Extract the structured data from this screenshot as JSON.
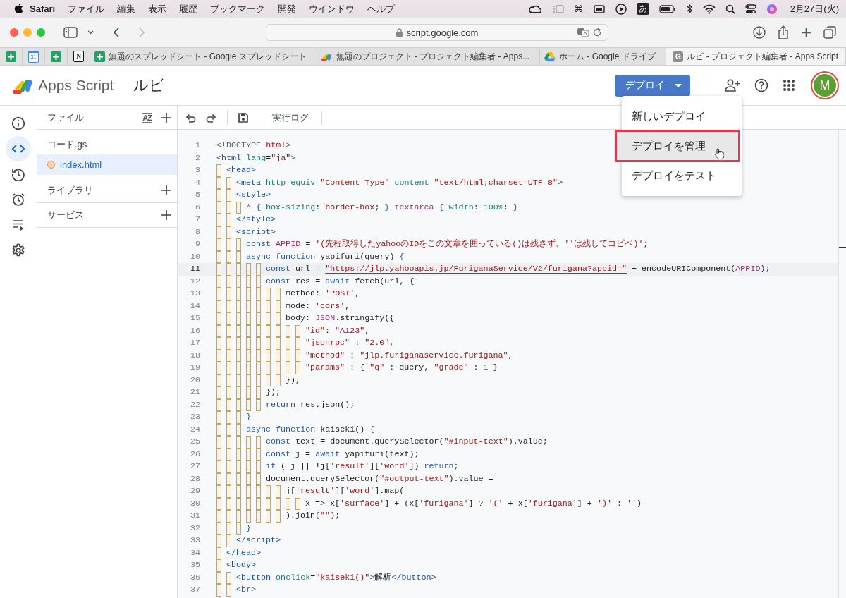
{
  "menubar": {
    "app": "Safari",
    "items": [
      "ファイル",
      "編集",
      "表示",
      "履歴",
      "ブックマーク",
      "開発",
      "ウインドウ",
      "ヘルプ"
    ],
    "command_glyph": "⌘",
    "input_mode": "あ",
    "clock": "2月27日(火)"
  },
  "browser": {
    "address": "script.google.com",
    "pinned_tabs": [
      {
        "kind": "sheets"
      },
      {
        "kind": "calendar",
        "icon_label": "31"
      },
      {
        "kind": "sheets"
      },
      {
        "kind": "notion",
        "icon_label": "N"
      }
    ],
    "tabs": [
      {
        "kind": "sheets",
        "title": "無題のスプレッドシート - Google スプレッドシート",
        "selected": false
      },
      {
        "kind": "apps-script",
        "title": "無題のプロジェクト - プロジェクト編集者 - Apps...",
        "selected": false
      },
      {
        "kind": "drive",
        "title": "ホーム - Google ドライブ",
        "selected": false
      },
      {
        "kind": "letter",
        "icon_label": "G",
        "title": "ルビ - プロジェクト編集者 - Apps Script",
        "selected": true
      }
    ]
  },
  "header": {
    "product": "Apps Script",
    "project": "ルビ",
    "deploy_button": "デプロイ",
    "avatar": "M"
  },
  "deploy_menu": [
    {
      "label": "新しいデプロイ",
      "highlighted": false
    },
    {
      "label": "デプロイを管理",
      "highlighted": true
    },
    {
      "label": "デプロイをテスト",
      "highlighted": false
    }
  ],
  "rail": [
    {
      "kind": "info",
      "selected": false
    },
    {
      "kind": "code",
      "selected": true
    },
    {
      "kind": "history",
      "selected": false
    },
    {
      "kind": "alarm",
      "selected": false
    },
    {
      "kind": "executions",
      "selected": false
    },
    {
      "kind": "settings",
      "selected": false
    }
  ],
  "files": {
    "title": "ファイル",
    "sort_label": "AZ",
    "items": [
      {
        "name": "コード.gs",
        "selected": false,
        "unsaved": false
      },
      {
        "name": "index.html",
        "selected": true,
        "unsaved": true
      }
    ],
    "sections": [
      "ライブラリ",
      "サービス"
    ]
  },
  "editor": {
    "log_button": "実行ログ",
    "lines": [
      {
        "number": "1",
        "current": false,
        "tokens": [
          {
            "kind": "meta",
            "text": "<!DOCTYPE "
          },
          {
            "kind": "string",
            "text": "html"
          },
          {
            "kind": "meta",
            "text": ">"
          }
        ]
      },
      {
        "number": "2",
        "current": false,
        "tokens": [
          {
            "kind": "tag",
            "text": "<html "
          },
          {
            "kind": "attr",
            "text": "lang"
          },
          {
            "kind": "plain",
            "text": "="
          },
          {
            "kind": "string",
            "text": "\"ja\""
          },
          {
            "kind": "tag",
            "text": ">"
          }
        ]
      },
      {
        "number": "3",
        "current": false,
        "tokens": [
          {
            "kind": "tag",
            "text": "  <head>"
          }
        ]
      },
      {
        "number": "4",
        "current": false,
        "tokens": [
          {
            "kind": "tag",
            "text": "    <meta "
          },
          {
            "kind": "attr",
            "text": "http-equiv"
          },
          {
            "kind": "plain",
            "text": "="
          },
          {
            "kind": "string",
            "text": "\"Content-Type\""
          },
          {
            "kind": "attr",
            "text": " content"
          },
          {
            "kind": "plain",
            "text": "="
          },
          {
            "kind": "string",
            "text": "\"text/html;charset=UTF-8\""
          },
          {
            "kind": "tag",
            "text": ">"
          }
        ]
      },
      {
        "number": "5",
        "current": false,
        "tokens": [
          {
            "kind": "tag",
            "text": "    <style>"
          }
        ]
      },
      {
        "number": "6",
        "current": false,
        "tokens": [
          {
            "kind": "var",
            "text": "      *"
          },
          {
            "kind": "bracket",
            "text": " {"
          },
          {
            "kind": "attr",
            "text": " box-sizing"
          },
          {
            "kind": "plain",
            "text": ": "
          },
          {
            "kind": "string",
            "text": "border-box"
          },
          {
            "kind": "plain",
            "text": "; "
          },
          {
            "kind": "bracket",
            "text": "}"
          },
          {
            "kind": "var",
            "text": " textarea"
          },
          {
            "kind": "bracket",
            "text": " {"
          },
          {
            "kind": "attr",
            "text": " width"
          },
          {
            "kind": "plain",
            "text": ": "
          },
          {
            "kind": "number",
            "text": "100%"
          },
          {
            "kind": "plain",
            "text": "; "
          },
          {
            "kind": "bracket",
            "text": "}"
          }
        ]
      },
      {
        "number": "7",
        "current": false,
        "tokens": [
          {
            "kind": "tag",
            "text": "    </style>"
          }
        ]
      },
      {
        "number": "8",
        "current": false,
        "tokens": [
          {
            "kind": "tag",
            "text": "    <script>"
          }
        ]
      },
      {
        "number": "9",
        "current": false,
        "tokens": [
          {
            "kind": "keyword",
            "text": "      const"
          },
          {
            "kind": "var",
            "text": " APPID"
          },
          {
            "kind": "plain",
            "text": " = "
          },
          {
            "kind": "string",
            "text": "'(先程取得したyahooのIDをこの文章を囲っている()は残さず、''は残してコピペ)'"
          },
          {
            "kind": "plain",
            "text": ";"
          }
        ]
      },
      {
        "number": "10",
        "current": false,
        "tokens": [
          {
            "kind": "keyword",
            "text": "      async function"
          },
          {
            "kind": "plain",
            "text": " yapifuri(query) "
          },
          {
            "kind": "bracket",
            "text": "{"
          }
        ]
      },
      {
        "number": "11",
        "current": true,
        "tokens": [
          {
            "kind": "keyword",
            "text": "          const"
          },
          {
            "kind": "plain",
            "text": " url = "
          },
          {
            "kind": "error-string",
            "text": "\"https://jlp.yahooapis.jp/FuriganaService/V2/furigana?appid=\""
          },
          {
            "kind": "plain",
            "text": " + encodeURIComponent("
          },
          {
            "kind": "var",
            "text": "APPID"
          },
          {
            "kind": "plain",
            "text": ");"
          }
        ]
      },
      {
        "number": "12",
        "current": false,
        "tokens": [
          {
            "kind": "keyword",
            "text": "          const"
          },
          {
            "kind": "plain",
            "text": " res = "
          },
          {
            "kind": "keyword",
            "text": "await"
          },
          {
            "kind": "plain",
            "text": " fetch(url, {"
          }
        ]
      },
      {
        "number": "13",
        "current": false,
        "tokens": [
          {
            "kind": "plain",
            "text": "              method: "
          },
          {
            "kind": "string",
            "text": "'POST'"
          },
          {
            "kind": "plain",
            "text": ","
          }
        ]
      },
      {
        "number": "14",
        "current": false,
        "tokens": [
          {
            "kind": "plain",
            "text": "              mode: "
          },
          {
            "kind": "string",
            "text": "'cors'"
          },
          {
            "kind": "plain",
            "text": ","
          }
        ]
      },
      {
        "number": "15",
        "current": false,
        "tokens": [
          {
            "kind": "plain",
            "text": "              body: "
          },
          {
            "kind": "var",
            "text": "JSON"
          },
          {
            "kind": "plain",
            "text": ".stringify({"
          }
        ]
      },
      {
        "number": "16",
        "current": false,
        "tokens": [
          {
            "kind": "string",
            "text": "                  \"id\""
          },
          {
            "kind": "plain",
            "text": ": "
          },
          {
            "kind": "string",
            "text": "\"A123\""
          },
          {
            "kind": "plain",
            "text": ","
          }
        ]
      },
      {
        "number": "17",
        "current": false,
        "tokens": [
          {
            "kind": "string",
            "text": "                  \"jsonrpc\""
          },
          {
            "kind": "plain",
            "text": " : "
          },
          {
            "kind": "string",
            "text": "\"2.0\""
          },
          {
            "kind": "plain",
            "text": ","
          }
        ]
      },
      {
        "number": "18",
        "current": false,
        "tokens": [
          {
            "kind": "string",
            "text": "                  \"method\""
          },
          {
            "kind": "plain",
            "text": " : "
          },
          {
            "kind": "string",
            "text": "\"jlp.furiganaservice.furigana\""
          },
          {
            "kind": "plain",
            "text": ","
          }
        ]
      },
      {
        "number": "19",
        "current": false,
        "tokens": [
          {
            "kind": "string",
            "text": "                  \"params\""
          },
          {
            "kind": "plain",
            "text": " : { "
          },
          {
            "kind": "string",
            "text": "\"q\""
          },
          {
            "kind": "plain",
            "text": " : query, "
          },
          {
            "kind": "string",
            "text": "\"grade\""
          },
          {
            "kind": "plain",
            "text": " : "
          },
          {
            "kind": "number",
            "text": "1"
          },
          {
            "kind": "plain",
            "text": " }"
          }
        ]
      },
      {
        "number": "20",
        "current": false,
        "tokens": [
          {
            "kind": "plain",
            "text": "              }),"
          }
        ]
      },
      {
        "number": "21",
        "current": false,
        "tokens": [
          {
            "kind": "plain",
            "text": "          });"
          }
        ]
      },
      {
        "number": "22",
        "current": false,
        "tokens": [
          {
            "kind": "keyword",
            "text": "          return"
          },
          {
            "kind": "plain",
            "text": " res.json();"
          }
        ]
      },
      {
        "number": "23",
        "current": false,
        "tokens": [
          {
            "kind": "bracket",
            "text": "      }"
          }
        ]
      },
      {
        "number": "24",
        "current": false,
        "tokens": [
          {
            "kind": "keyword",
            "text": "      async function"
          },
          {
            "kind": "plain",
            "text": " kaiseki() "
          },
          {
            "kind": "bracket",
            "text": "{"
          }
        ]
      },
      {
        "number": "25",
        "current": false,
        "tokens": [
          {
            "kind": "keyword",
            "text": "          const"
          },
          {
            "kind": "plain",
            "text": " text = document.querySelector("
          },
          {
            "kind": "string",
            "text": "\"#input-text\""
          },
          {
            "kind": "plain",
            "text": ").value;"
          }
        ]
      },
      {
        "number": "26",
        "current": false,
        "tokens": [
          {
            "kind": "keyword",
            "text": "          const"
          },
          {
            "kind": "plain",
            "text": " j = "
          },
          {
            "kind": "keyword",
            "text": "await"
          },
          {
            "kind": "plain",
            "text": " yapifuri(text);"
          }
        ]
      },
      {
        "number": "27",
        "current": false,
        "tokens": [
          {
            "kind": "keyword",
            "text": "          if"
          },
          {
            "kind": "plain",
            "text": " (!j || !j["
          },
          {
            "kind": "string",
            "text": "'result'"
          },
          {
            "kind": "plain",
            "text": "]["
          },
          {
            "kind": "string",
            "text": "'word'"
          },
          {
            "kind": "plain",
            "text": "]) "
          },
          {
            "kind": "keyword",
            "text": "return"
          },
          {
            "kind": "plain",
            "text": ";"
          }
        ]
      },
      {
        "number": "28",
        "current": false,
        "tokens": [
          {
            "kind": "plain",
            "text": "          document.querySelector("
          },
          {
            "kind": "string",
            "text": "\"#output-text\""
          },
          {
            "kind": "plain",
            "text": ").value ="
          }
        ]
      },
      {
        "number": "29",
        "current": false,
        "tokens": [
          {
            "kind": "plain",
            "text": "              j["
          },
          {
            "kind": "string",
            "text": "'result'"
          },
          {
            "kind": "plain",
            "text": "]["
          },
          {
            "kind": "string",
            "text": "'word'"
          },
          {
            "kind": "plain",
            "text": "].map("
          }
        ]
      },
      {
        "number": "30",
        "current": false,
        "tokens": [
          {
            "kind": "plain",
            "text": "                  x => x["
          },
          {
            "kind": "string",
            "text": "'surface'"
          },
          {
            "kind": "plain",
            "text": "] + (x["
          },
          {
            "kind": "string",
            "text": "'furigana'"
          },
          {
            "kind": "plain",
            "text": "] ? "
          },
          {
            "kind": "string",
            "text": "'('"
          },
          {
            "kind": "plain",
            "text": " + x["
          },
          {
            "kind": "string",
            "text": "'furigana'"
          },
          {
            "kind": "plain",
            "text": "] + "
          },
          {
            "kind": "string",
            "text": "')'"
          },
          {
            "kind": "plain",
            "text": " : "
          },
          {
            "kind": "string",
            "text": "''"
          },
          {
            "kind": "plain",
            "text": ")"
          }
        ]
      },
      {
        "number": "31",
        "current": false,
        "tokens": [
          {
            "kind": "plain",
            "text": "              ).join("
          },
          {
            "kind": "string",
            "text": "\"\""
          },
          {
            "kind": "plain",
            "text": ");"
          }
        ]
      },
      {
        "number": "32",
        "current": false,
        "tokens": [
          {
            "kind": "bracket",
            "text": "      }"
          }
        ]
      },
      {
        "number": "33",
        "current": false,
        "tokens": [
          {
            "kind": "tag",
            "text": "    </script>"
          }
        ]
      },
      {
        "number": "34",
        "current": false,
        "tokens": [
          {
            "kind": "tag",
            "text": "  </head>"
          }
        ]
      },
      {
        "number": "35",
        "current": false,
        "tokens": [
          {
            "kind": "tag",
            "text": "  <body>"
          }
        ]
      },
      {
        "number": "36",
        "current": false,
        "tokens": [
          {
            "kind": "tag",
            "text": "    <button "
          },
          {
            "kind": "attr",
            "text": "onclick"
          },
          {
            "kind": "plain",
            "text": "="
          },
          {
            "kind": "string",
            "text": "\"kaiseki()\""
          },
          {
            "kind": "tag",
            "text": ">"
          },
          {
            "kind": "plain",
            "text": "解析"
          },
          {
            "kind": "tag",
            "text": "</button>"
          }
        ]
      },
      {
        "number": "37",
        "current": false,
        "tokens": [
          {
            "kind": "tag",
            "text": "    <br>"
          }
        ]
      }
    ]
  }
}
